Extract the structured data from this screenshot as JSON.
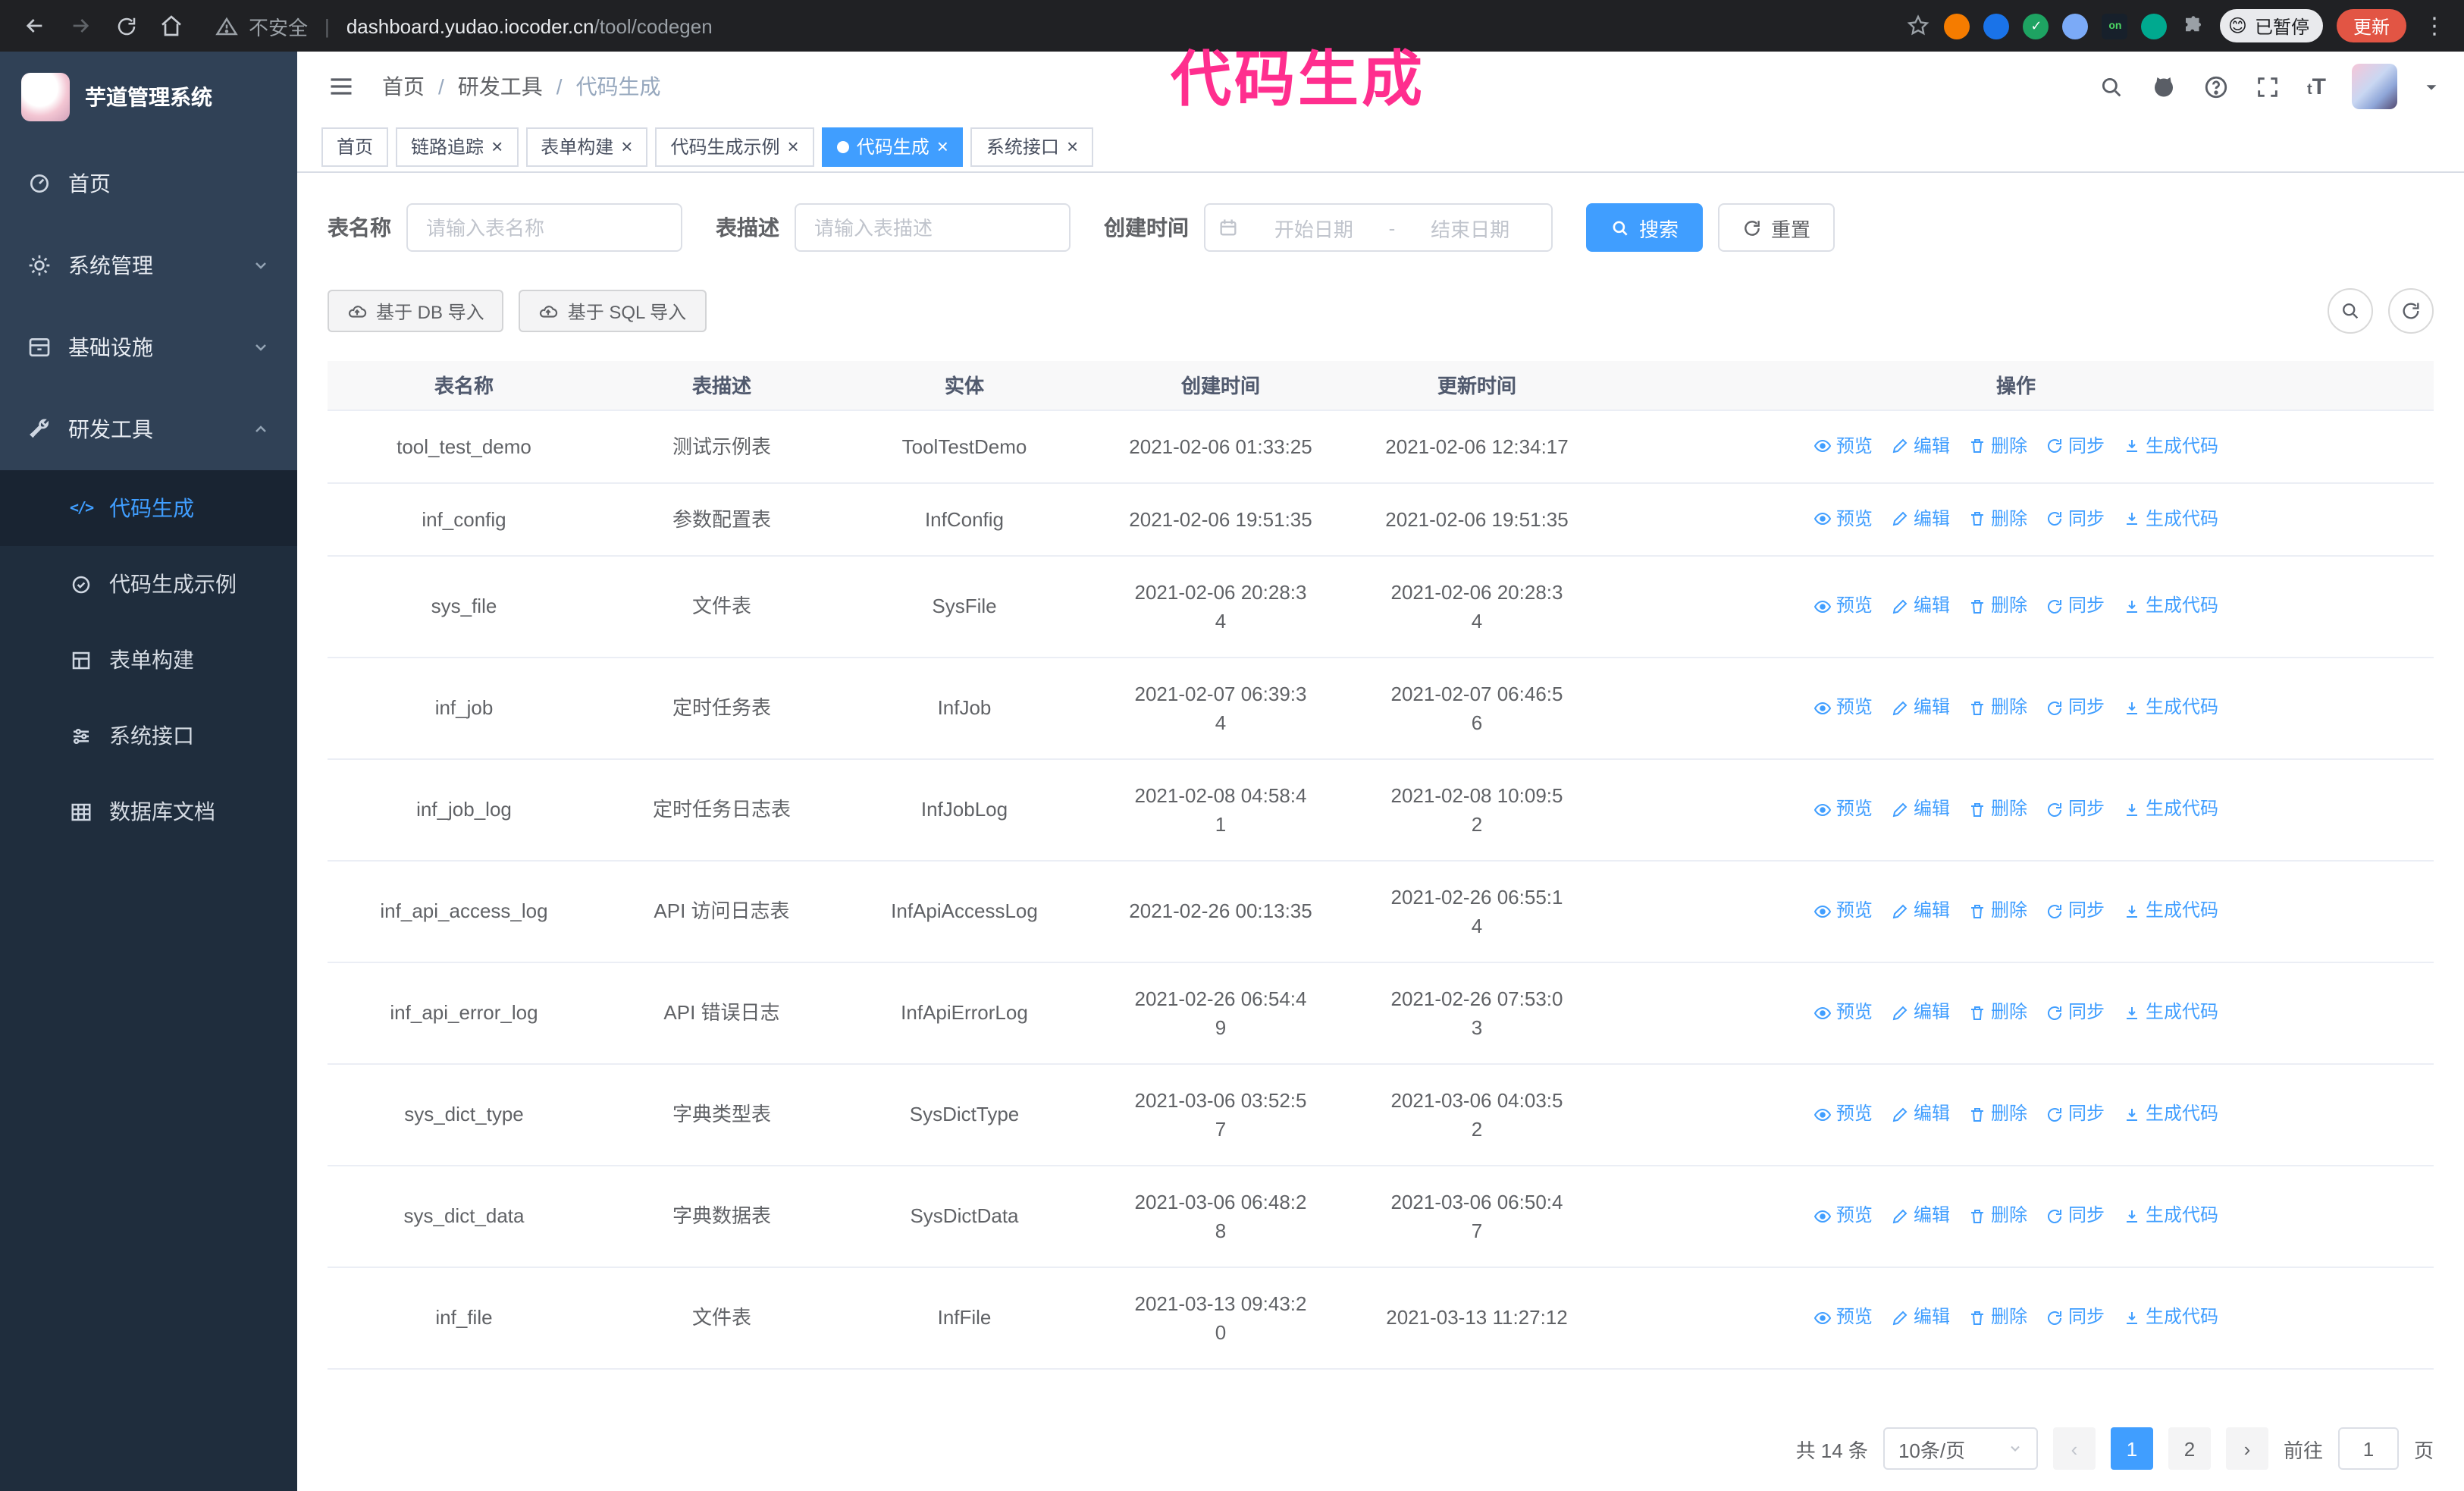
{
  "annotation": {
    "overlay_title": "代码生成"
  },
  "colors": {
    "accent": "#409eff",
    "overlay_pink": "#ff2e8e",
    "sidebar_bg": "#304156",
    "submenu_bg": "#1f2d3d",
    "update_btn": "#e25544"
  },
  "browser": {
    "security_label": "不安全",
    "url_host": "dashboard.yudao.iocoder.cn",
    "url_path": "/tool/codegen",
    "profile_emoji": "😊",
    "profile_badge": "已暂停",
    "update_button": "更新",
    "extension_on_label": "on"
  },
  "sidebar": {
    "app_title": "芋道管理系统",
    "items": [
      {
        "label": "首页"
      },
      {
        "label": "系统管理"
      },
      {
        "label": "基础设施"
      },
      {
        "label": "研发工具"
      }
    ],
    "subitems": [
      {
        "label": "代码生成"
      },
      {
        "label": "代码生成示例"
      },
      {
        "label": "表单构建"
      },
      {
        "label": "系统接口"
      },
      {
        "label": "数据库文档"
      }
    ]
  },
  "header": {
    "breadcrumb": [
      "首页",
      "研发工具",
      "代码生成"
    ]
  },
  "tabs": [
    {
      "label": "首页"
    },
    {
      "label": "链路追踪"
    },
    {
      "label": "表单构建"
    },
    {
      "label": "代码生成示例"
    },
    {
      "label": "代码生成"
    },
    {
      "label": "系统接口"
    }
  ],
  "filters": {
    "table_name_label": "表名称",
    "table_name_placeholder": "请输入表名称",
    "table_desc_label": "表描述",
    "table_desc_placeholder": "请输入表描述",
    "create_time_label": "创建时间",
    "date_start_placeholder": "开始日期",
    "date_separator": "-",
    "date_end_placeholder": "结束日期",
    "search_button": "搜索",
    "reset_button": "重置"
  },
  "toolbar": {
    "import_db_button": "基于 DB 导入",
    "import_sql_button": "基于 SQL 导入"
  },
  "table": {
    "columns": [
      "表名称",
      "表描述",
      "实体",
      "创建时间",
      "更新时间",
      "操作"
    ],
    "row_actions": [
      "预览",
      "编辑",
      "删除",
      "同步",
      "生成代码"
    ],
    "rows": [
      {
        "name": "tool_test_demo",
        "desc": "测试示例表",
        "entity": "ToolTestDemo",
        "created": "2021-02-06 01:33:25",
        "updated": "2021-02-06 12:34:17"
      },
      {
        "name": "inf_config",
        "desc": "参数配置表",
        "entity": "InfConfig",
        "created": "2021-02-06 19:51:35",
        "updated": "2021-02-06 19:51:35"
      },
      {
        "name": "sys_file",
        "desc": "文件表",
        "entity": "SysFile",
        "created": "2021-02-06 20:28:3\n4",
        "updated": "2021-02-06 20:28:3\n4"
      },
      {
        "name": "inf_job",
        "desc": "定时任务表",
        "entity": "InfJob",
        "created": "2021-02-07 06:39:3\n4",
        "updated": "2021-02-07 06:46:5\n6"
      },
      {
        "name": "inf_job_log",
        "desc": "定时任务日志表",
        "entity": "InfJobLog",
        "created": "2021-02-08 04:58:4\n1",
        "updated": "2021-02-08 10:09:5\n2"
      },
      {
        "name": "inf_api_access_log",
        "desc": "API 访问日志表",
        "entity": "InfApiAccessLog",
        "created": "2021-02-26 00:13:35",
        "updated": "2021-02-26 06:55:1\n4"
      },
      {
        "name": "inf_api_error_log",
        "desc": "API 错误日志",
        "entity": "InfApiErrorLog",
        "created": "2021-02-26 06:54:4\n9",
        "updated": "2021-02-26 07:53:0\n3"
      },
      {
        "name": "sys_dict_type",
        "desc": "字典类型表",
        "entity": "SysDictType",
        "created": "2021-03-06 03:52:5\n7",
        "updated": "2021-03-06 04:03:5\n2"
      },
      {
        "name": "sys_dict_data",
        "desc": "字典数据表",
        "entity": "SysDictData",
        "created": "2021-03-06 06:48:2\n8",
        "updated": "2021-03-06 06:50:4\n7"
      },
      {
        "name": "inf_file",
        "desc": "文件表",
        "entity": "InfFile",
        "created": "2021-03-13 09:43:2\n0",
        "updated": "2021-03-13 11:27:12"
      }
    ]
  },
  "pagination": {
    "total": "共 14 条",
    "page_size": "10条/页",
    "page_1": "1",
    "page_2": "2",
    "goto_prefix": "前往",
    "goto_value": "1",
    "goto_suffix": "页"
  }
}
